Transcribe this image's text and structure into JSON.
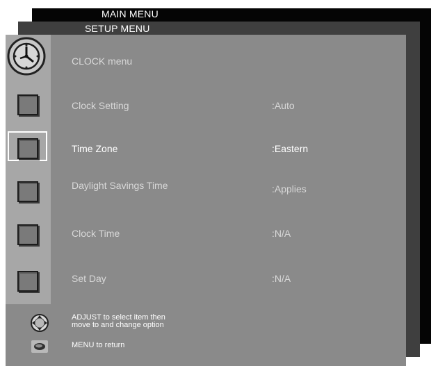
{
  "main_menu": {
    "title": "MAIN MENU"
  },
  "setup_menu": {
    "title": "SETUP MENU"
  },
  "clock_menu": {
    "title": "CLOCK menu",
    "items": [
      {
        "label": "Clock Setting",
        "value": ":Auto",
        "selected": false
      },
      {
        "label": "Time Zone",
        "value": ":Eastern",
        "selected": true
      },
      {
        "label": "Daylight Savings Time",
        "value": ":Applies",
        "selected": false
      },
      {
        "label": "Clock Time",
        "value": ":N/A",
        "selected": false
      },
      {
        "label": "Set Day",
        "value": ":N/A",
        "selected": false
      }
    ]
  },
  "help": {
    "adjust_line_1": "ADJUST to select item then",
    "adjust_line_2": "move to and change option",
    "menu_return": "MENU to return"
  },
  "colors": {
    "main_panel": "#050505",
    "setup_panel": "#3f3f3f",
    "clock_panel": "#8a8a8a",
    "sidebar": "#a7a7a7",
    "selected_text": "#ffffff",
    "dim_text": "#d8d8d8"
  }
}
